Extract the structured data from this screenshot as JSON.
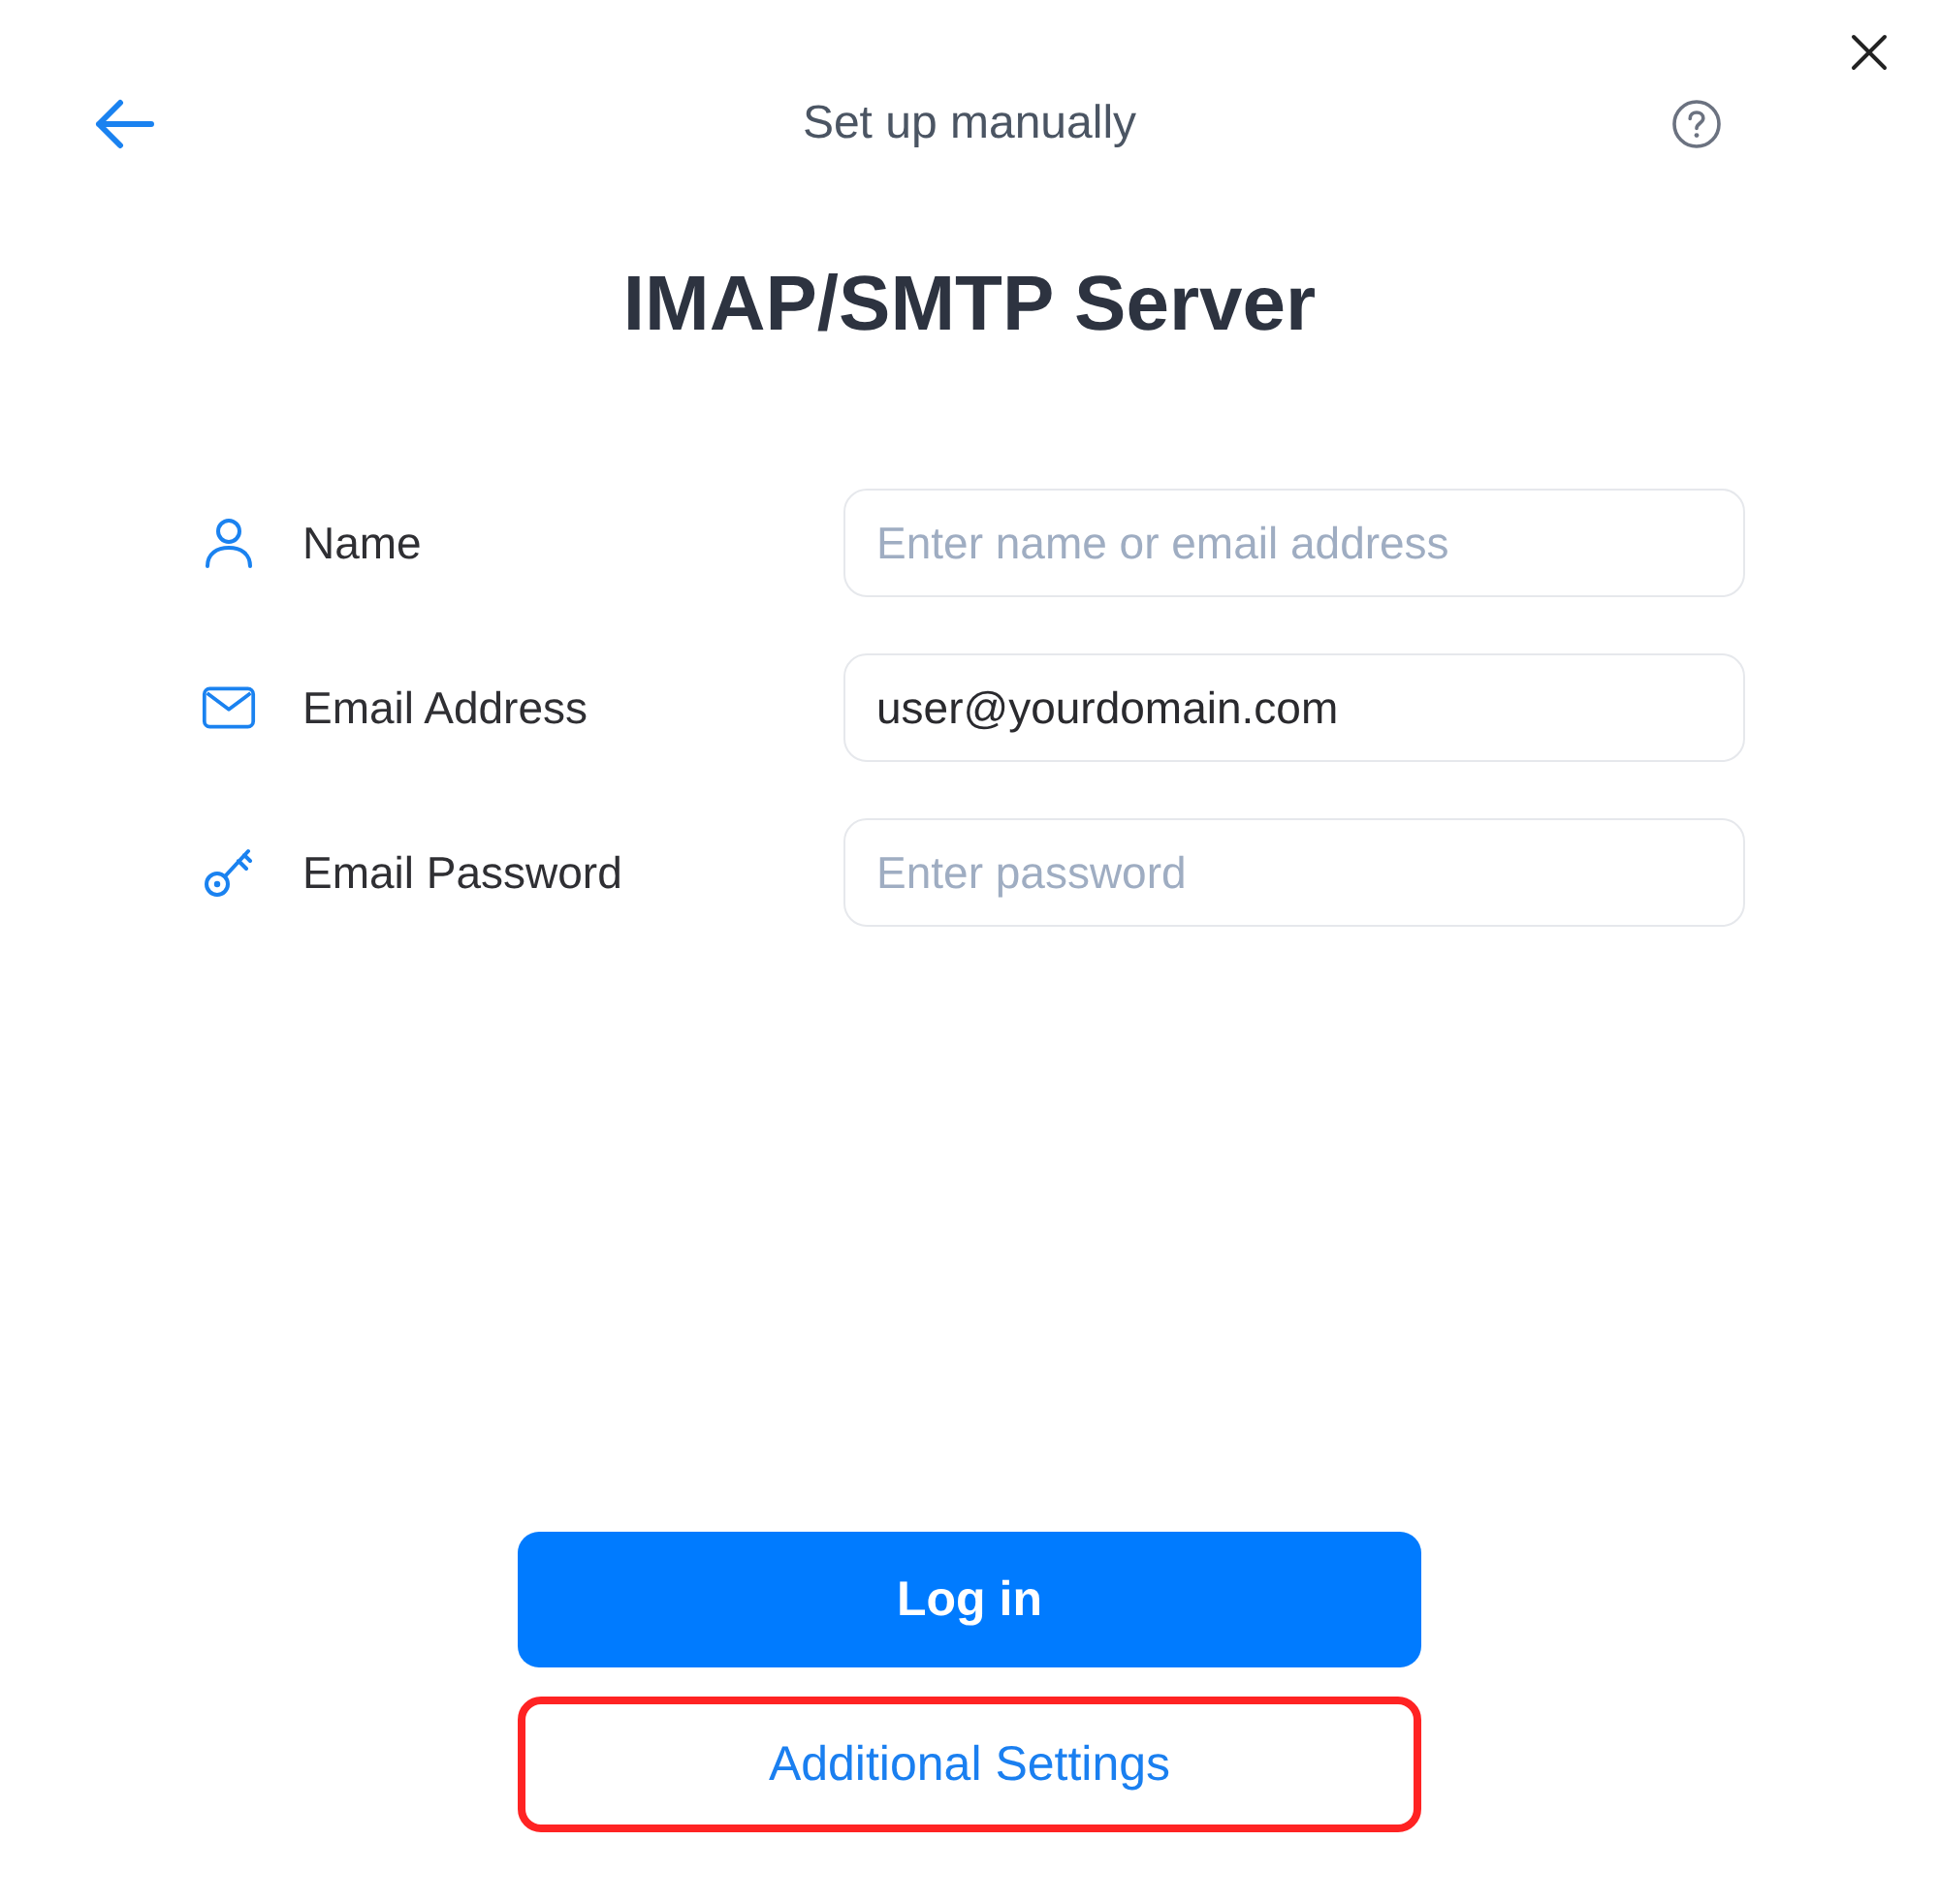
{
  "header": {
    "title": "Set up manually"
  },
  "heading": "IMAP/SMTP Server",
  "fields": [
    {
      "label": "Name",
      "placeholder": "Enter name or email address"
    },
    {
      "label": "Email Address",
      "value": "user@yourdomain.com"
    },
    {
      "label": "Email Password",
      "placeholder": "Enter password"
    }
  ],
  "buttons": [
    {
      "label": "Log in",
      "kind": "primary",
      "highlighted": false
    },
    {
      "label": "Additional Settings",
      "kind": "secondary",
      "highlighted": true
    }
  ]
}
